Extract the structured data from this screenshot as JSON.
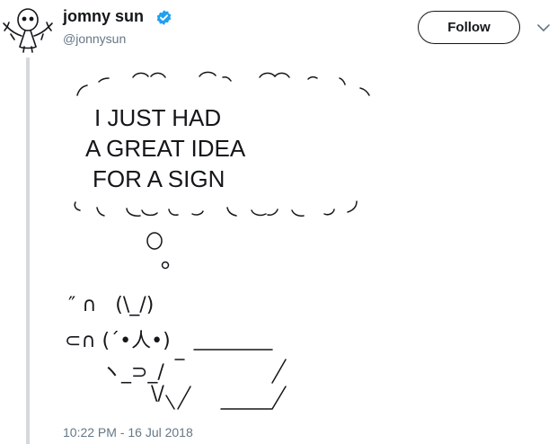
{
  "user": {
    "name": "jomny sun",
    "handle": "@jonnysun",
    "verified": true
  },
  "follow_label": "Follow",
  "tweet": {
    "lines": [
      "I JUST HAD",
      "A GREAT IDEA",
      "FOR A SIGN"
    ],
    "bunny": {
      "ears": "″ ∩   (\\_/)",
      "face": "⊂∩ (´•人•)",
      "slash": "\\"
    },
    "timestamp": "10:22 PM - 16 Jul 2018"
  },
  "colors": {
    "verified": "#1da1f2",
    "muted": "#657786",
    "thread": "#d5d9dd"
  }
}
